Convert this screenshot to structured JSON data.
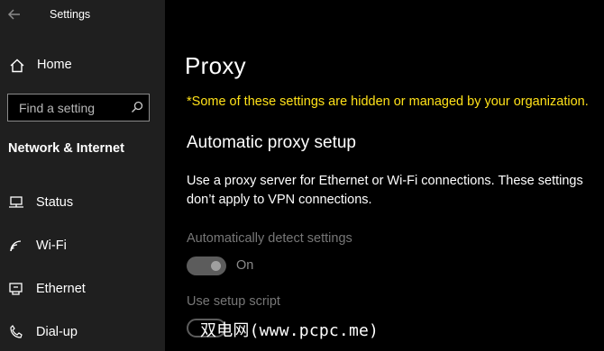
{
  "app": {
    "title": "Settings"
  },
  "sidebar": {
    "home_label": "Home",
    "search": {
      "placeholder": "Find a setting"
    },
    "section_title": "Network & Internet",
    "items": [
      {
        "label": "Status",
        "icon": "status-icon"
      },
      {
        "label": "Wi-Fi",
        "icon": "wifi-icon"
      },
      {
        "label": "Ethernet",
        "icon": "ethernet-icon"
      },
      {
        "label": "Dial-up",
        "icon": "dialup-icon"
      }
    ]
  },
  "main": {
    "title": "Proxy",
    "warning": "*Some of these settings are hidden or managed by your organization.",
    "auto_section": {
      "heading": "Automatic proxy setup",
      "description": "Use a proxy server for Ethernet or Wi-Fi connections. These settings don’t apply to VPN connections.",
      "detect_label": "Automatically detect settings",
      "detect_state": "On",
      "detect_on": true,
      "script_label": "Use setup script"
    }
  },
  "watermark": "双电网(www.pcpc.me)",
  "colors": {
    "warning": "#ffe119",
    "sidebar_bg": "#1f1f1f",
    "main_bg": "#000000"
  }
}
